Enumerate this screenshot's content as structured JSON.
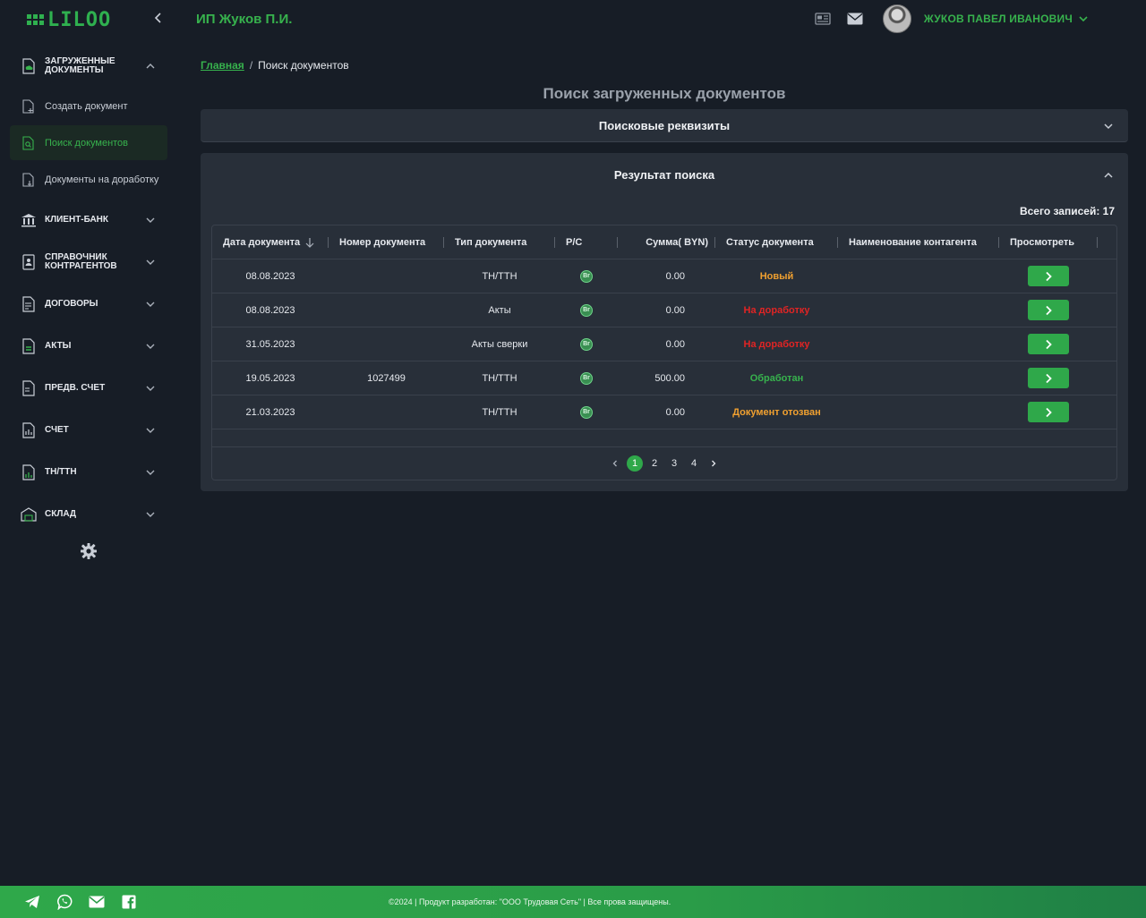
{
  "brand": {
    "logo_text": "LILOO"
  },
  "header": {
    "org_name": "ИП Жуков П.И.",
    "user_name": "ЖУКОВ ПАВЕЛ ИВАНОВИЧ"
  },
  "sidebar": {
    "sections": [
      {
        "label_line1": "ЗАГРУЖЕННЫЕ",
        "label_line2": "ДОКУМЕНТЫ",
        "expanded": true,
        "icon": "cloud-doc-icon",
        "items": [
          {
            "label": "Создать документ",
            "icon": "doc-plus-icon",
            "active": false
          },
          {
            "label": "Поиск документов",
            "icon": "doc-search-icon",
            "active": true
          },
          {
            "label": "Документы на доработку",
            "icon": "doc-edit-icon",
            "active": false
          }
        ]
      },
      {
        "label_line1": "КЛИЕНТ-БАНК",
        "label_line2": "",
        "icon": "bank-icon"
      },
      {
        "label_line1": "СПРАВОЧНИК",
        "label_line2": "КОНТРАГЕНТОВ",
        "icon": "contacts-book-icon"
      },
      {
        "label_line1": "ДОГОВОРЫ",
        "label_line2": "",
        "icon": "contract-icon"
      },
      {
        "label_line1": "АКТЫ",
        "label_line2": "",
        "icon": "acts-icon"
      },
      {
        "label_line1": "ПРЕДВ. СЧЕТ",
        "label_line2": "",
        "icon": "invoice-draft-icon"
      },
      {
        "label_line1": "СЧЕТ",
        "label_line2": "",
        "icon": "invoice-icon"
      },
      {
        "label_line1": "ТН/ТТН",
        "label_line2": "",
        "icon": "waybill-icon"
      },
      {
        "label_line1": "СКЛАД",
        "label_line2": "",
        "icon": "warehouse-icon"
      }
    ]
  },
  "breadcrumb": {
    "home": "Главная",
    "separator": "/",
    "current": "Поиск документов"
  },
  "page_title": "Поиск загруженных документов",
  "search_panel": {
    "title": "Поисковые реквизиты"
  },
  "result_panel": {
    "title": "Результат поиска",
    "total_label": "Всего записей: 17",
    "columns": [
      "Дата документа",
      "Номер документа",
      "Тип документа",
      "Р/С",
      "Сумма( BYN)",
      "Статус документа",
      "Наименование контагента",
      "Просмотреть"
    ],
    "rows": [
      {
        "date": "08.08.2023",
        "number": "",
        "type": "ТН/ТТН",
        "account": "Br",
        "sum": "0.00",
        "status": "Новый",
        "status_color": "#f0a030",
        "counterparty": ""
      },
      {
        "date": "08.08.2023",
        "number": "",
        "type": "Акты",
        "account": "Br",
        "sum": "0.00",
        "status": "На доработку",
        "status_color": "#e02424",
        "counterparty": ""
      },
      {
        "date": "31.05.2023",
        "number": "",
        "type": "Акты сверки",
        "account": "Br",
        "sum": "0.00",
        "status": "На доработку",
        "status_color": "#e02424",
        "counterparty": ""
      },
      {
        "date": "19.05.2023",
        "number": "1027499",
        "type": "ТН/ТТН",
        "account": "Br",
        "sum": "500.00",
        "status": "Обработан",
        "status_color": "#37b24d",
        "counterparty": ""
      },
      {
        "date": "21.03.2023",
        "number": "",
        "type": "ТН/ТТН",
        "account": "Br",
        "sum": "0.00",
        "status": "Документ отозван",
        "status_color": "#f0a030",
        "counterparty": ""
      }
    ],
    "pagination": {
      "pages": [
        "1",
        "2",
        "3",
        "4"
      ],
      "current": "1"
    }
  },
  "footer": {
    "copyright": "©2024 | Продукт разработан: \"ООО Трудовая Сеть\" | Все прова защищены.",
    "social_icons": [
      "telegram-icon",
      "viber-icon",
      "mail-icon",
      "facebook-icon"
    ]
  }
}
